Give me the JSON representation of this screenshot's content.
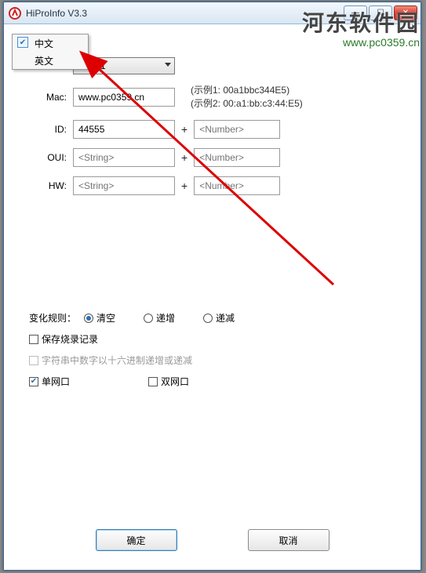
{
  "window": {
    "title": "HiProInfo V3.3",
    "buttons": {
      "min": "—",
      "max": "☐",
      "close": "✕"
    }
  },
  "watermark": {
    "cn": "河东软件园",
    "url": "www.pc0359.cn"
  },
  "langmenu": {
    "items": [
      {
        "label": "中文",
        "checked": true
      },
      {
        "label": "英文",
        "checked": false
      }
    ]
  },
  "fields": {
    "com": {
      "label": "",
      "value": "COM1"
    },
    "mac": {
      "label": "Mac:",
      "value": "www.pc0359.cn"
    },
    "mac_hint1": "(示例1: 00a1bbc344E5)",
    "mac_hint2": "(示例2: 00:a1:bb:c3:44:E5)",
    "id": {
      "label": "ID:",
      "value": "44555",
      "plus": "+",
      "num_placeholder": "<Number>"
    },
    "oui": {
      "label": "OUI:",
      "placeholder": "<String>",
      "plus": "+",
      "num_placeholder": "<Number>"
    },
    "hw": {
      "label": "HW:",
      "placeholder": "<String>",
      "plus": "+",
      "num_placeholder": "<Number>"
    }
  },
  "rules": {
    "label": "变化规则：",
    "options": [
      "清空",
      "递增",
      "递减"
    ],
    "selected": 0
  },
  "checks": {
    "save_record": {
      "label": "保存烧录记录",
      "checked": false
    },
    "hex_incdec": {
      "label": "字符串中数字以十六进制递增或递减",
      "checked": false,
      "disabled": true
    },
    "single_port": {
      "label": "单网口",
      "checked": true
    },
    "dual_port": {
      "label": "双网口",
      "checked": false
    }
  },
  "buttons": {
    "ok": "确定",
    "cancel": "取消"
  }
}
